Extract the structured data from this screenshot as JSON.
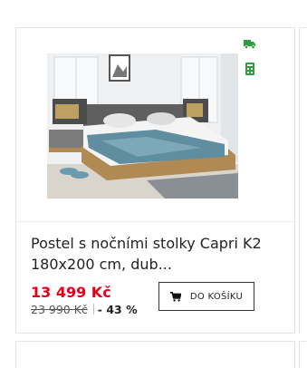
{
  "product": {
    "title": "Postel s nočními stolky Capri K2 180x200 cm, dub...",
    "price": "13 499 Kč",
    "old_price": "23 990 Kč",
    "discount": "- 43 %",
    "image_alt": "bed-with-nightstands-photo"
  },
  "actions": {
    "add_to_cart_label": "DO KOŠÍKU"
  },
  "badges": [
    {
      "icon": "delivery-truck-icon",
      "color": "#2e9e3f"
    },
    {
      "icon": "store-stock-icon",
      "color": "#2e9e3f"
    }
  ],
  "colors": {
    "price": "#e2001a",
    "badge_green": "#2e9e3f",
    "border": "#e4e4e4"
  }
}
